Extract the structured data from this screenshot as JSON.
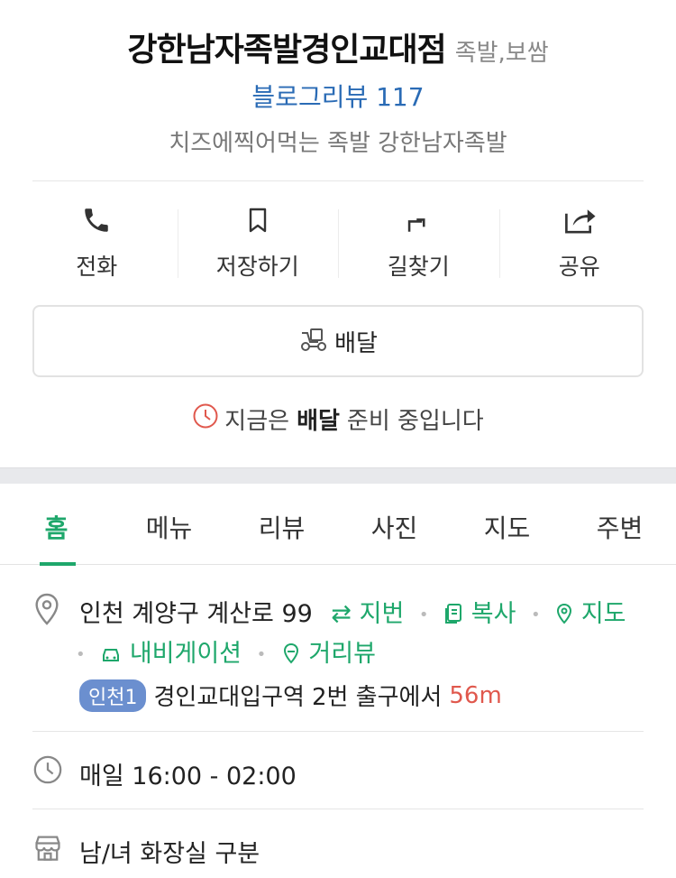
{
  "header": {
    "title": "강한남자족발경인교대점",
    "category": "족발,보쌈",
    "review": "블로그리뷰 117",
    "description": "치즈에찍어먹는 족발 강한남자족발"
  },
  "actions": [
    {
      "label": "전화",
      "icon": "phone-icon"
    },
    {
      "label": "저장하기",
      "icon": "bookmark-icon"
    },
    {
      "label": "길찾기",
      "icon": "directions-icon"
    },
    {
      "label": "공유",
      "icon": "share-icon"
    }
  ],
  "delivery": {
    "label": "배달",
    "icon": "delivery-scooter-icon"
  },
  "status": {
    "prefix": "지금은",
    "emphasis": "배달",
    "suffix": "준비 중입니다"
  },
  "tabs": [
    {
      "label": "홈",
      "active": true
    },
    {
      "label": "메뉴",
      "active": false
    },
    {
      "label": "리뷰",
      "active": false
    },
    {
      "label": "사진",
      "active": false
    },
    {
      "label": "지도",
      "active": false
    },
    {
      "label": "주변",
      "active": false
    }
  ],
  "address": {
    "text": "인천 계양구 계산로 99",
    "links": [
      "지번",
      "복사",
      "지도",
      "내비게이션",
      "거리뷰"
    ],
    "subway": {
      "line": "인천1",
      "station": "경인교대입구역",
      "exit": "2번 출구에서",
      "distance": "56m"
    }
  },
  "hours": {
    "text": "매일 16:00 - 02:00"
  },
  "facilities": {
    "text": "남/녀 화장실 구분"
  },
  "colors": {
    "accent": "#1ea76b",
    "link_blue": "#2a6bb5",
    "distance_red": "#e0584d",
    "clock_red": "#e0584d",
    "subway_badge": "#6b8fcf"
  }
}
